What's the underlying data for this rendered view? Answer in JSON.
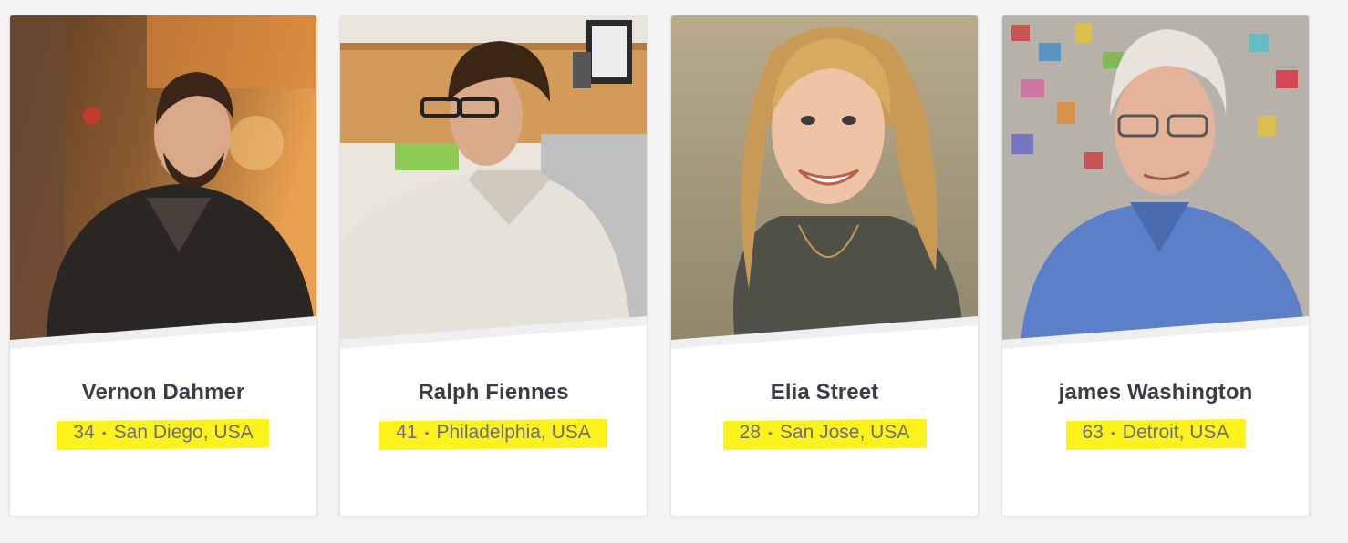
{
  "people": [
    {
      "name": "Vernon Dahmer",
      "age": "34",
      "location": "San Diego, USA",
      "photo_icon": "man-bearded-hoodie-photo"
    },
    {
      "name": "Ralph Fiennes",
      "age": "41",
      "location": "Philadelphia, USA",
      "photo_icon": "man-glasses-sweater-photo"
    },
    {
      "name": "Elia Street",
      "age": "28",
      "location": "San Jose, USA",
      "photo_icon": "woman-blonde-smiling-photo"
    },
    {
      "name": "james Washington",
      "age": "63",
      "location": "Detroit, USA",
      "photo_icon": "older-man-glasses-photo"
    }
  ],
  "separator": "•",
  "colors": {
    "background": "#f4f4f5",
    "card": "#ffffff",
    "name_text": "#3a3d45",
    "meta_text": "#6b6f78",
    "highlight": "#fdf21c"
  }
}
